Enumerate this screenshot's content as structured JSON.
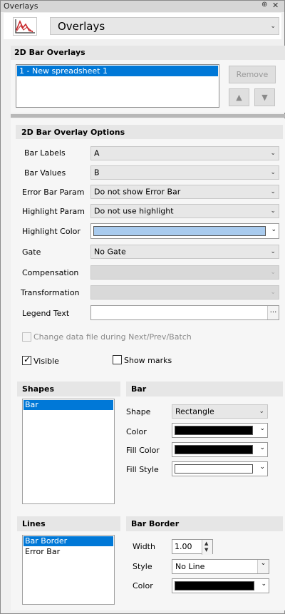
{
  "window": {
    "title": "Overlays",
    "pin_glyph": "⊕",
    "close_glyph": "✕"
  },
  "header": {
    "icon": "overlay-chart-icon",
    "dropdown_value": "Overlays"
  },
  "bar_overlays": {
    "section_title": "2D Bar Overlays",
    "items": [
      "1 - New spreadsheet 1"
    ],
    "remove_label": "Remove",
    "up_glyph": "▲",
    "down_glyph": "▼"
  },
  "options": {
    "section_title": "2D Bar Overlay Options",
    "bar_labels": {
      "label": "Bar Labels",
      "value": "A"
    },
    "bar_values": {
      "label": "Bar Values",
      "value": "B"
    },
    "error_bar_param": {
      "label": "Error Bar Param",
      "value": "Do not show Error Bar"
    },
    "highlight_param": {
      "label": "Highlight Param",
      "value": "Do not use highlight"
    },
    "highlight_color": {
      "label": "Highlight Color",
      "value": "#a9cbee"
    },
    "gate": {
      "label": "Gate",
      "value": "No Gate"
    },
    "compensation": {
      "label": "Compensation",
      "value": ""
    },
    "transformation": {
      "label": "Transformation",
      "value": ""
    },
    "legend_text": {
      "label": "Legend Text",
      "value": "",
      "browse": "..."
    },
    "change_data_file": {
      "label": "Change data file during Next/Prev/Batch",
      "checked": false,
      "enabled": false
    },
    "visible": {
      "label": "Visible",
      "checked": true
    },
    "show_marks": {
      "label": "Show marks",
      "checked": false
    }
  },
  "shapes": {
    "title": "Shapes",
    "items": [
      "Bar"
    ],
    "selected": 0
  },
  "bar": {
    "title": "Bar",
    "shape": {
      "label": "Shape",
      "value": "Rectangle"
    },
    "color": {
      "label": "Color",
      "value": "#000000"
    },
    "fill_color": {
      "label": "Fill Color",
      "value": "#000000"
    },
    "fill_style": {
      "label": "Fill Style",
      "value": "#ffffff"
    }
  },
  "lines": {
    "title": "Lines",
    "items": [
      "Bar Border",
      "Error Bar"
    ],
    "selected": 0
  },
  "bar_border": {
    "title": "Bar Border",
    "width": {
      "label": "Width",
      "value": "1.00"
    },
    "style": {
      "label": "Style",
      "value": "No Line"
    },
    "color": {
      "label": "Color",
      "value": "#000000"
    }
  }
}
